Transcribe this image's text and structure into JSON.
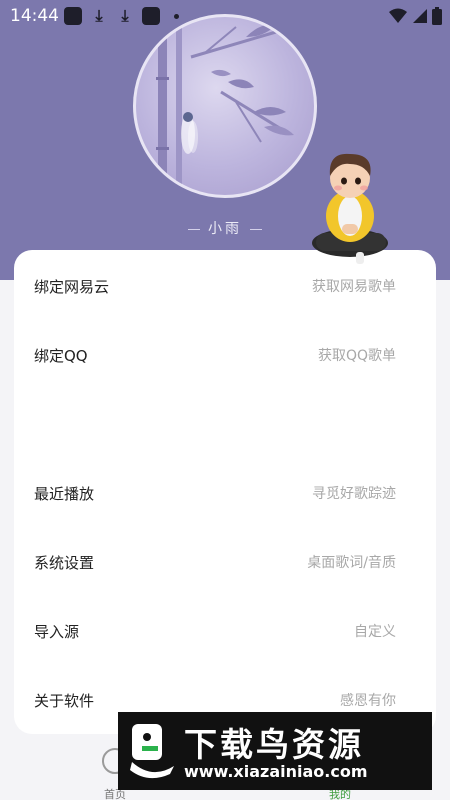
{
  "status_bar": {
    "time": "14:44"
  },
  "profile": {
    "username": "小雨"
  },
  "menu": {
    "items": [
      {
        "title": "绑定网易云",
        "subtitle": "获取网易歌单"
      },
      {
        "title": "绑定QQ",
        "subtitle": "获取QQ歌单"
      },
      {
        "title": "最近播放",
        "subtitle": "寻觅好歌踪迹"
      },
      {
        "title": "系统设置",
        "subtitle": "桌面歌词/音质"
      },
      {
        "title": "导入源",
        "subtitle": "自定义"
      },
      {
        "title": "关于软件",
        "subtitle": "感恩有你"
      }
    ]
  },
  "bottom_nav": {
    "home_label": "首页",
    "me_label": "我的"
  },
  "watermark": {
    "title": "下载鸟资源",
    "url": "www.xiazainiao.com"
  },
  "colors": {
    "header_bg": "#7c78ad",
    "card_bg": "#ffffff",
    "active_tab": "#3f9e3f"
  }
}
